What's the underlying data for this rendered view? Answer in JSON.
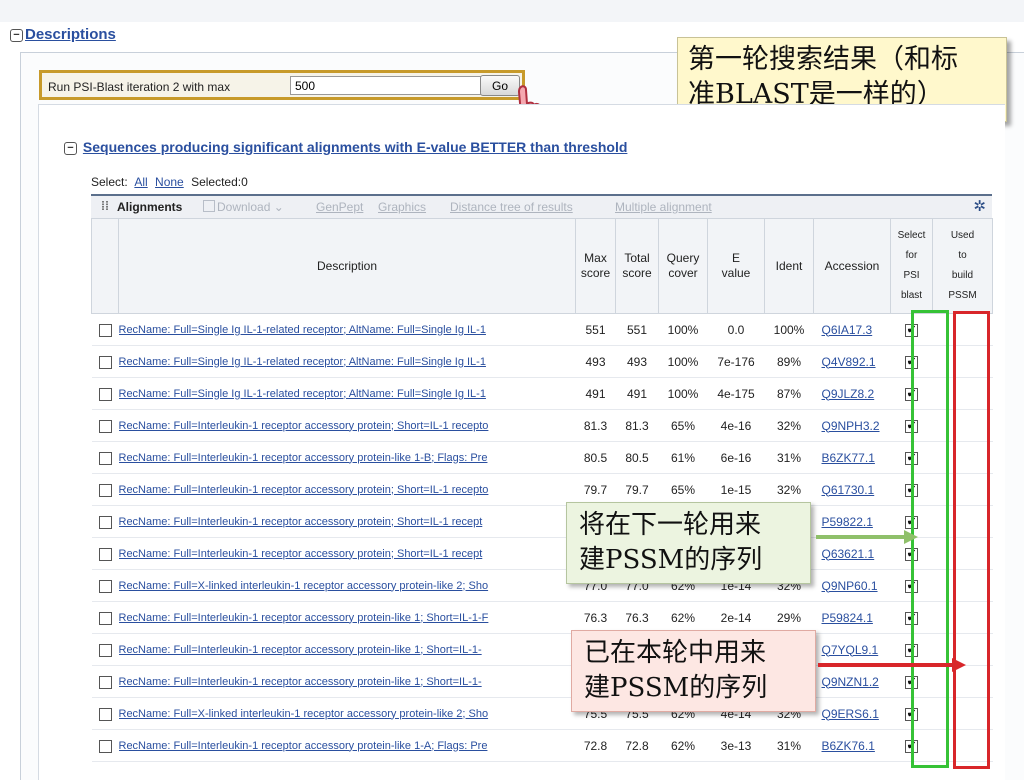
{
  "descriptions_title": "Descriptions",
  "run_psi": {
    "label": "Run PSI-Blast iteration 2 with max",
    "value": "500",
    "go_label": "Go"
  },
  "note_top": {
    "line1": "第一轮搜索结果（和标",
    "line2": "准BLAST是一样的）"
  },
  "note_green": {
    "line1": "将在下一轮用来",
    "line2": "建PSSM的序列"
  },
  "note_red": {
    "line1": "已在本轮中用来",
    "line2": "建PSSM的序列"
  },
  "section_title": "Sequences producing significant alignments with E-value BETTER than threshold",
  "select": {
    "label": "Select:",
    "all": "All",
    "none": "None",
    "selected": "Selected:0"
  },
  "toolbar": {
    "dots": "⁞⁞",
    "alignments": "Alignments",
    "download": "Download",
    "genpept": "GenPept",
    "graphics": "Graphics",
    "distance_tree": "Distance tree of results",
    "multiple_alignment": "Multiple alignment"
  },
  "columns": {
    "description": "Description",
    "max_score": [
      "Max",
      "score"
    ],
    "total_score": [
      "Total",
      "score"
    ],
    "query_cover": [
      "Query",
      "cover"
    ],
    "e_value": [
      "E",
      "value"
    ],
    "ident": "Ident",
    "accession": "Accession",
    "select_psi": [
      "Select",
      "for",
      "PSI",
      "blast"
    ],
    "used_pssm": [
      "Used",
      "to",
      "build",
      "PSSM"
    ]
  },
  "rows": [
    {
      "desc": "RecName: Full=Single Ig IL-1-related receptor; AltName: Full=Single Ig IL-1",
      "max": "551",
      "total": "551",
      "cover": "100%",
      "evalue": "0.0",
      "ident": "100%",
      "acc": "Q6IA17.3"
    },
    {
      "desc": "RecName: Full=Single Ig IL-1-related receptor; AltName: Full=Single Ig IL-1",
      "max": "493",
      "total": "493",
      "cover": "100%",
      "evalue": "7e-176",
      "ident": "89%",
      "acc": "Q4V892.1"
    },
    {
      "desc": "RecName: Full=Single Ig IL-1-related receptor; AltName: Full=Single Ig IL-1",
      "max": "491",
      "total": "491",
      "cover": "100%",
      "evalue": "4e-175",
      "ident": "87%",
      "acc": "Q9JLZ8.2"
    },
    {
      "desc": "RecName: Full=Interleukin-1 receptor accessory protein; Short=IL-1 recepto",
      "max": "81.3",
      "total": "81.3",
      "cover": "65%",
      "evalue": "4e-16",
      "ident": "32%",
      "acc": "Q9NPH3.2"
    },
    {
      "desc": "RecName: Full=Interleukin-1 receptor accessory protein-like 1-B; Flags: Pre",
      "max": "80.5",
      "total": "80.5",
      "cover": "61%",
      "evalue": "6e-16",
      "ident": "31%",
      "acc": "B6ZK77.1"
    },
    {
      "desc": "RecName: Full=Interleukin-1 receptor accessory protein; Short=IL-1 recepto",
      "max": "79.7",
      "total": "79.7",
      "cover": "65%",
      "evalue": "1e-15",
      "ident": "32%",
      "acc": "Q61730.1"
    },
    {
      "desc": "RecName: Full=Interleukin-1 receptor accessory protein; Short=IL-1 recept",
      "max": "",
      "total": "",
      "cover": "",
      "evalue": "",
      "ident": "",
      "acc": "P59822.1"
    },
    {
      "desc": "RecName: Full=Interleukin-1 receptor accessory protein; Short=IL-1 recept",
      "max": "",
      "total": "",
      "cover": "",
      "evalue": "",
      "ident": "",
      "acc": "Q63621.1"
    },
    {
      "desc": "RecName: Full=X-linked interleukin-1 receptor accessory protein-like 2; Sho",
      "max": "77.0",
      "total": "77.0",
      "cover": "62%",
      "evalue": "1e-14",
      "ident": "32%",
      "acc": "Q9NP60.1"
    },
    {
      "desc": "RecName: Full=Interleukin-1 receptor accessory protein-like 1; Short=IL-1-F",
      "max": "76.3",
      "total": "76.3",
      "cover": "62%",
      "evalue": "2e-14",
      "ident": "29%",
      "acc": "P59824.1"
    },
    {
      "desc": "RecName: Full=Interleukin-1 receptor accessory protein-like 1; Short=IL-1-",
      "max": "",
      "total": "",
      "cover": "",
      "evalue": "",
      "ident": "",
      "acc": "Q7YQL9.1"
    },
    {
      "desc": "RecName: Full=Interleukin-1 receptor accessory protein-like 1; Short=IL-1-",
      "max": "",
      "total": "",
      "cover": "",
      "evalue": "",
      "ident": "",
      "acc": "Q9NZN1.2"
    },
    {
      "desc": "RecName: Full=X-linked interleukin-1 receptor accessory protein-like 2; Sho",
      "max": "75.5",
      "total": "75.5",
      "cover": "62%",
      "evalue": "4e-14",
      "ident": "32%",
      "acc": "Q9ERS6.1"
    },
    {
      "desc": "RecName: Full=Interleukin-1 receptor accessory protein-like 1-A; Flags: Pre",
      "max": "72.8",
      "total": "72.8",
      "cover": "62%",
      "evalue": "3e-13",
      "ident": "31%",
      "acc": "B6ZK76.1"
    }
  ],
  "colors": {
    "link": "#2a4f9f",
    "highlight_orange": "#c79a2a",
    "green_box": "#36c236",
    "red_box": "#d8262a"
  },
  "icons": {
    "gear": "gear-icon",
    "hand": "hand-pointer-icon",
    "collapse": "minus-box-icon"
  }
}
